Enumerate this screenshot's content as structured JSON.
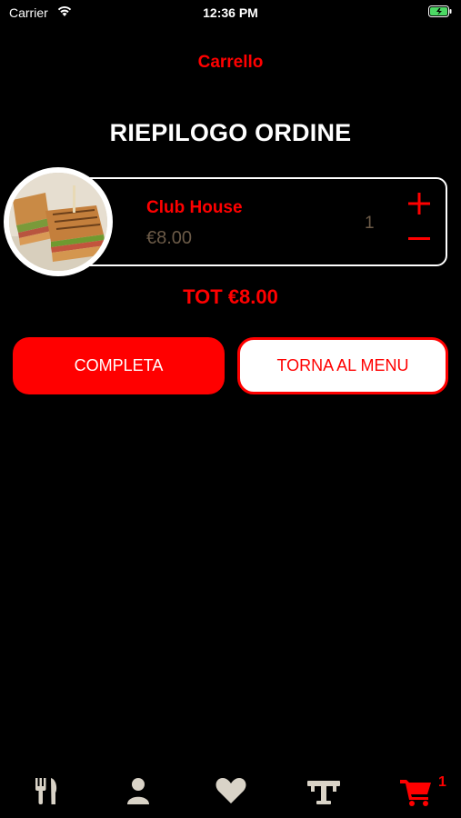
{
  "status_bar": {
    "carrier": "Carrier",
    "time": "12:36 PM"
  },
  "nav": {
    "title": "Carrello"
  },
  "page": {
    "title": "RIEPILOGO ORDINE"
  },
  "cart": {
    "items": [
      {
        "name": "Club House",
        "price": "€8.00",
        "quantity": "1"
      }
    ],
    "total": "TOT €8.00"
  },
  "actions": {
    "complete": "COMPLETA",
    "back": "TORNA AL MENU"
  },
  "tabbar": {
    "tabs": [
      {
        "icon": "fork-knife-icon"
      },
      {
        "icon": "user-icon"
      },
      {
        "icon": "heart-icon"
      },
      {
        "icon": "table-icon"
      },
      {
        "icon": "cart-icon",
        "active": true
      }
    ],
    "cart_badge": "1"
  },
  "colors": {
    "accent": "#ff0000",
    "background": "#000000",
    "price": "#6b5a47",
    "tab_inactive": "#d9d3c7"
  }
}
